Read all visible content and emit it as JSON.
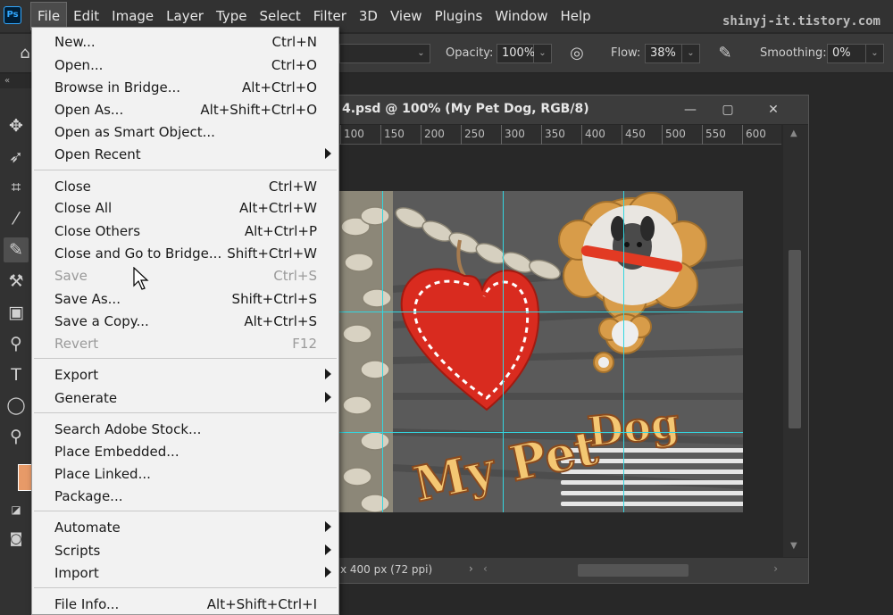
{
  "app": {
    "logo": "Ps",
    "watermark": "shinyj-it.tistory.com"
  },
  "menubar": {
    "items": [
      "File",
      "Edit",
      "Image",
      "Layer",
      "Type",
      "Select",
      "Filter",
      "3D",
      "View",
      "Plugins",
      "Window",
      "Help"
    ]
  },
  "options": {
    "opacity_label": "Opacity:",
    "opacity_value": "100%",
    "flow_label": "Flow:",
    "flow_value": "38%",
    "smoothing_label": "Smoothing:",
    "smoothing_value": "0%"
  },
  "document": {
    "title": "4.psd @ 100% (My Pet Dog, RGB/8)",
    "status": "x 400 px (72 ppi)",
    "ruler_labels": [
      "100",
      "150",
      "200",
      "250",
      "300",
      "350",
      "400",
      "450",
      "500",
      "550",
      "600"
    ],
    "art_title_left": "My Pet",
    "art_title_right": "Dog"
  },
  "file_menu": {
    "items": [
      {
        "label": "New...",
        "shortcut": "Ctrl+N"
      },
      {
        "label": "Open...",
        "shortcut": "Ctrl+O"
      },
      {
        "label": "Browse in Bridge...",
        "shortcut": "Alt+Ctrl+O"
      },
      {
        "label": "Open As...",
        "shortcut": "Alt+Shift+Ctrl+O"
      },
      {
        "label": "Open as Smart Object...",
        "shortcut": ""
      },
      {
        "label": "Open Recent",
        "shortcut": "",
        "submenu": true
      },
      {
        "label": "Close",
        "shortcut": "Ctrl+W"
      },
      {
        "label": "Close All",
        "shortcut": "Alt+Ctrl+W"
      },
      {
        "label": "Close Others",
        "shortcut": "Alt+Ctrl+P"
      },
      {
        "label": "Close and Go to Bridge...",
        "shortcut": "Shift+Ctrl+W"
      },
      {
        "label": "Save",
        "shortcut": "Ctrl+S",
        "disabled": true
      },
      {
        "label": "Save As...",
        "shortcut": "Shift+Ctrl+S"
      },
      {
        "label": "Save a Copy...",
        "shortcut": "Alt+Ctrl+S"
      },
      {
        "label": "Revert",
        "shortcut": "F12",
        "disabled": true
      },
      {
        "label": "Export",
        "shortcut": "",
        "submenu": true
      },
      {
        "label": "Generate",
        "shortcut": "",
        "submenu": true
      },
      {
        "label": "Search Adobe Stock...",
        "shortcut": ""
      },
      {
        "label": "Place Embedded...",
        "shortcut": ""
      },
      {
        "label": "Place Linked...",
        "shortcut": ""
      },
      {
        "label": "Package...",
        "shortcut": ""
      },
      {
        "label": "Automate",
        "shortcut": "",
        "submenu": true
      },
      {
        "label": "Scripts",
        "shortcut": "",
        "submenu": true
      },
      {
        "label": "Import",
        "shortcut": "",
        "submenu": true
      },
      {
        "label": "File Info...",
        "shortcut": "Alt+Shift+Ctrl+I"
      }
    ]
  }
}
